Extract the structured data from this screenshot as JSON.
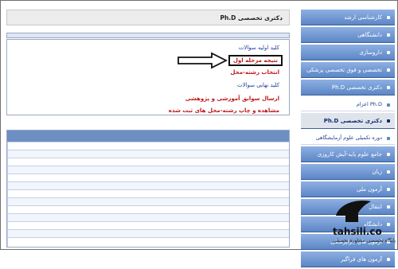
{
  "main": {
    "title": "دکتری تخصصی Ph.D",
    "items": [
      {
        "label": "کلید اولیه سوالات",
        "color": "blue"
      },
      {
        "label": "نتیجه مرحله اول",
        "color": "red",
        "highlighted": true
      },
      {
        "label": "انتخاب رشته-محل",
        "color": "red"
      },
      {
        "label": "کلید نهایی سوالات",
        "color": "blue"
      },
      {
        "label": "ارسال سوابق آموزشی و پژوهشی",
        "color": "red"
      },
      {
        "label": "مشاهده و چاپ رشته-محل های ثبت شده",
        "color": "red"
      }
    ]
  },
  "sidebar": {
    "items": [
      {
        "label": "کارشناسی ارشد",
        "type": "main"
      },
      {
        "label": "دانشنگاهی",
        "type": "main"
      },
      {
        "label": "داروسازی",
        "type": "main"
      },
      {
        "label": "تخصصی و فوق تخصصی پزشکی",
        "type": "main"
      },
      {
        "label": "دکتری تخصصی Ph.D",
        "type": "main"
      },
      {
        "label": "Ph.D اعزام",
        "type": "sub"
      },
      {
        "label": "دکتری تخصصی Ph.D",
        "type": "active"
      },
      {
        "label": "دوره تکمیلی علوم آزمایشگاهی",
        "type": "sub"
      },
      {
        "label": "جامع علوم پایه-آیش کاروزی",
        "type": "main"
      },
      {
        "label": "زبان",
        "type": "main"
      },
      {
        "label": "آزمون ملی",
        "type": "main"
      },
      {
        "label": "انتقال",
        "type": "main"
      },
      {
        "label": "دانشگاه",
        "type": "main"
      },
      {
        "label": "آزمون های پیراپزشکی",
        "type": "main"
      },
      {
        "label": "آزمون های فراگیر",
        "type": "main"
      }
    ]
  },
  "watermark": {
    "site": "tahsili.co",
    "tagline": "پایگاه تخصصی مشاوره تحصیلی"
  }
}
